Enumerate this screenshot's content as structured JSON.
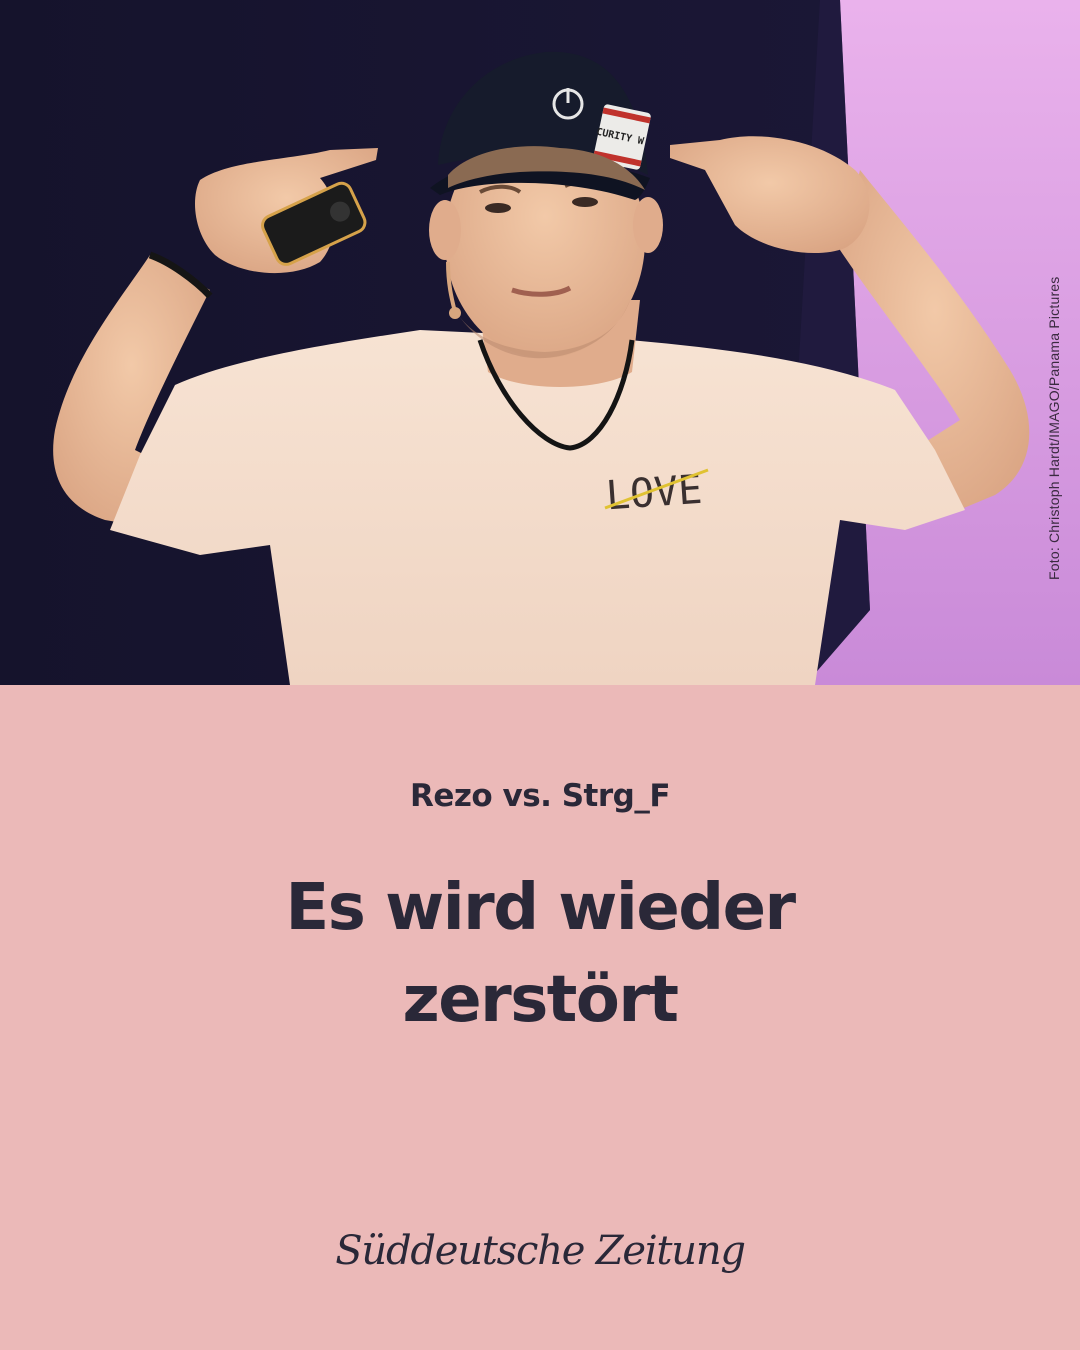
{
  "photo": {
    "credit": "Foto: Christoph Hardt/IMAGO/Panama Pictures",
    "shirt_text": "LOVE",
    "cap_patch_text": "CURITY W"
  },
  "article": {
    "kicker": "Rezo vs. Strg_F",
    "headline": "Es wird wieder zerstört"
  },
  "brand": {
    "logo_text": "Süddeutsche Zeitung"
  },
  "colors": {
    "panel_background": "#ebb9b8",
    "text": "#2a2838",
    "stage_dark": "#15142e",
    "stage_pink": "#e8a6e6"
  }
}
